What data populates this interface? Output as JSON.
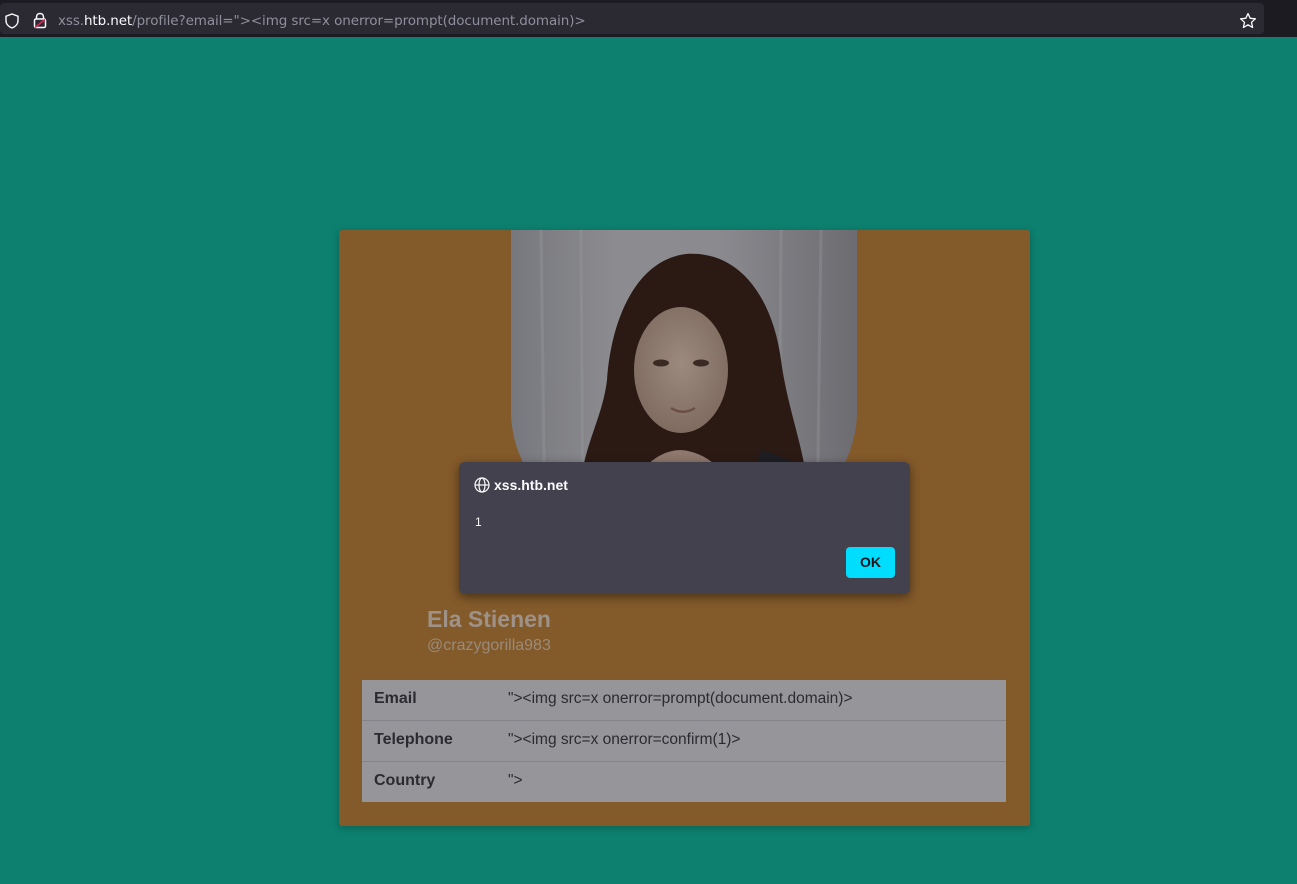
{
  "browser": {
    "url_prefix": "xss.",
    "url_host": "htb.net",
    "url_path": "/profile?email=\"><img src=x onerror=prompt(document.domain)>"
  },
  "profile": {
    "name": "Ela Stienen",
    "handle": "@crazygorilla983",
    "fields": [
      {
        "label": "Email",
        "value": "\"><img src=x onerror=prompt(document.domain)>"
      },
      {
        "label": "Telephone",
        "value": "\"><img src=x onerror=confirm(1)>"
      },
      {
        "label": "Country",
        "value": "\">"
      }
    ]
  },
  "dialog": {
    "origin": "xss.htb.net",
    "message": "1",
    "ok_label": "OK"
  },
  "colors": {
    "page_background": "#0d806f",
    "card_background": "#835a2a",
    "dialog_background": "#42414d",
    "ok_button": "#00ddff"
  },
  "icons": [
    "shield-icon",
    "lock-icon",
    "star-icon",
    "globe-icon"
  ]
}
